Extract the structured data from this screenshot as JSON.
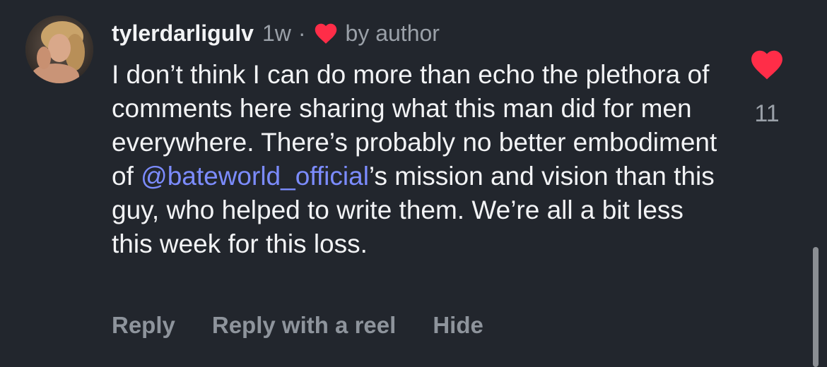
{
  "comment": {
    "username": "tylerdarligulv",
    "time": "1w",
    "separator": "·",
    "author_liked_label": "by author",
    "text_before_mention": "I don’t think I can do more than echo the plethora of comments here sharing what this man did for men everywhere. There’s probably no better embodiment of ",
    "mention": "@bateworld_official",
    "text_after_mention": "’s mission and vision than this guy, who helped to write them. We’re all a bit less this week for this loss.",
    "like_count": "11",
    "liked": true,
    "icons": {
      "author_heart": "heart-icon",
      "like_button": "heart-icon"
    }
  },
  "actions": {
    "reply": "Reply",
    "reply_with_reel": "Reply with a reel",
    "hide": "Hide"
  },
  "colors": {
    "background": "#22262d",
    "text": "#f2f3f5",
    "muted": "#9aa0a8",
    "mention": "#7c8cff",
    "heart": "#ff2d48"
  }
}
